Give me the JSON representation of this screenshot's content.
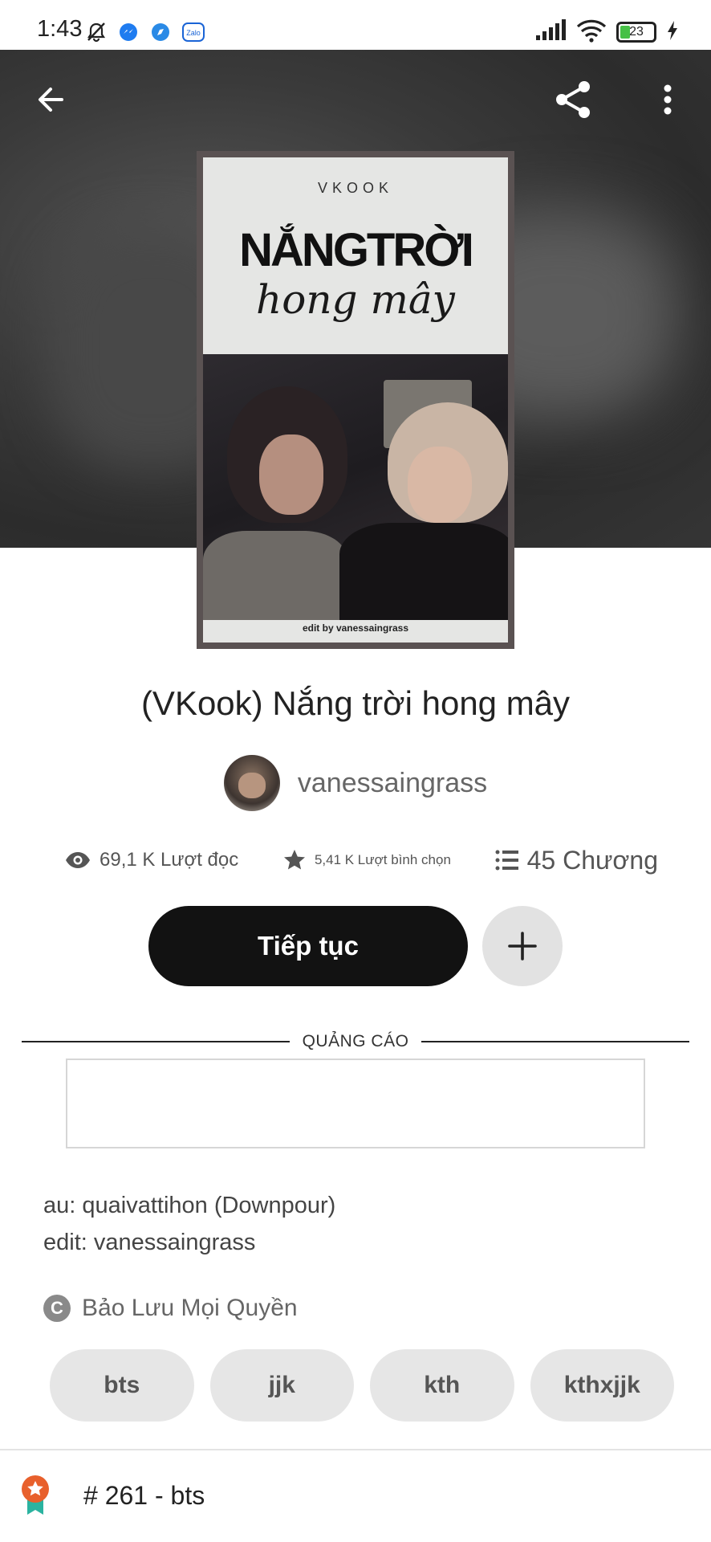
{
  "status_bar": {
    "time": "1:43",
    "battery_level": "23",
    "left_icons": [
      "muted-bell-icon",
      "messenger-icon",
      "browser-icon",
      "zalo-icon"
    ],
    "zalo_label": "Zalo",
    "right_icons": [
      "signal-icon",
      "wifi-icon",
      "battery-icon",
      "charging-icon"
    ]
  },
  "toolbar": {
    "back_icon": "back-arrow-icon",
    "share_icon": "share-icon",
    "menu_icon": "more-vert-icon"
  },
  "cover": {
    "author_line": "VKOOK",
    "title_line": "NẮNGTRỜI",
    "subtitle_line": "hong mây",
    "credit": "edit by vanessaingrass"
  },
  "story": {
    "title": "(VKook) Nắng trời hong mây",
    "author": "vanessaingrass"
  },
  "stats": {
    "reads": "69,1 K Lượt đọc",
    "votes": "5,41 K Lượt bình chọn",
    "chapters": "45 Chương"
  },
  "actions": {
    "continue_label": "Tiếp tục",
    "add_icon": "plus-icon"
  },
  "ad": {
    "label": "QUẢNG CÁO"
  },
  "description": {
    "line1": "au: quaivattihon (Downpour)",
    "line2": "edit: vanessaingrass"
  },
  "copyright": {
    "symbol": "C",
    "label": "Bảo Lưu Mọi Quyền"
  },
  "tags": [
    "bts",
    "jjk",
    "kth",
    "kthxjjk"
  ],
  "ranking": {
    "text": "# 261 - bts"
  },
  "colors": {
    "primary_button": "#121212",
    "tag_bg": "#e6e6e6",
    "badge_orange": "#e8602c",
    "badge_ribbon": "#2bb3a0",
    "battery_green": "#46c046"
  }
}
